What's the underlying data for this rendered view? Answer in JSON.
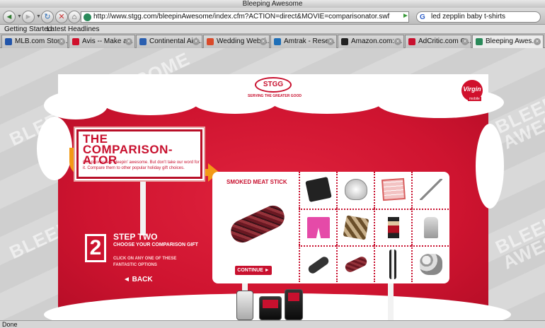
{
  "window": {
    "title": "Bleeping Awesome"
  },
  "toolbar": {
    "url": "http://www.stgg.com/bleepinAwesome/index.cfm?ACTION=direct&MOVIE=comparisonator.swf",
    "search_text": "led zepplin baby t-shirts"
  },
  "bookmarks": {
    "items": [
      "Getting Started",
      "Latest Headlines"
    ]
  },
  "tabs": [
    {
      "label": "MLB.com Store...",
      "color": "#2255aa"
    },
    {
      "label": "Avis -- Make a...",
      "color": "#d0102c"
    },
    {
      "label": "Continental Airl...",
      "color": "#2a5fb0"
    },
    {
      "label": "Wedding Websi...",
      "color": "#d94a2a"
    },
    {
      "label": "Amtrak - Rese...",
      "color": "#1e6fb8"
    },
    {
      "label": "Amazon.com: ...",
      "color": "#222222"
    },
    {
      "label": "AdCritic.com C...",
      "color": "#c8102e"
    },
    {
      "label": "Bleeping Awes...",
      "color": "#2a8a5a",
      "active": true
    }
  ],
  "page": {
    "watermark": "BLEEP IN AWESOME",
    "stgg_logo": "STGG",
    "stgg_tagline": "SERVING THE GREATER GOOD",
    "virgin_logo": "Virgin",
    "virgin_mobile": "mobile",
    "sign": {
      "title_line1": "THE",
      "title_line2": "COMPARISON-ATOR",
      "description": "Our phones are bleepin' awesome. But don't take our word for it. Compare them to other popular holiday gift choices."
    },
    "step": {
      "number": "2",
      "title": "STEP TWO",
      "subtitle": "CHOOSE YOUR COMPARISON GIFT",
      "instructions": "CLICK ON ANY ONE OF THESE FANTASTIC OPTIONS",
      "back_label": "◄ BACK"
    },
    "panel": {
      "selected_label": "SMOKED MEAT STICK",
      "continue_label": "CONTINUE ►"
    },
    "gift_options": [
      "calculator-icon",
      "salad-spinner-icon",
      "bingo-card-icon",
      "reacher-grabber-icon",
      "pink-shorts-icon",
      "argyle-socks-icon",
      "nutcracker-icon",
      "vacuum-icon",
      "hair-trimmer-icon",
      "meat-stick-icon",
      "thermometer-icon",
      "potpourri-icon"
    ],
    "colors": {
      "brand_red": "#c8102e",
      "arrow_orange": "#f39a16"
    }
  },
  "status": {
    "text": "Done"
  }
}
